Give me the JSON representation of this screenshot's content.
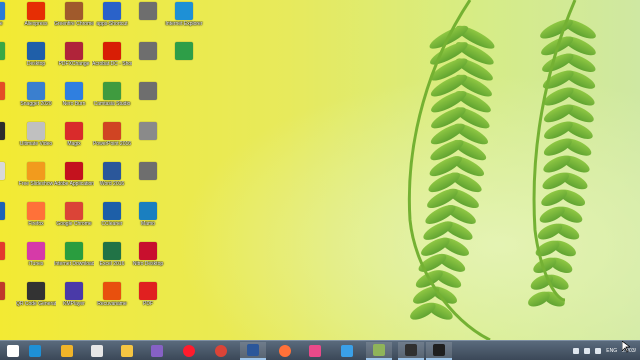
{
  "desktop": {
    "icons": [
      {
        "id": "ic-c0r0",
        "label": "...nDe",
        "color": "#2b7bd6",
        "col": 0,
        "row": 0
      },
      {
        "id": "ic-c0r1",
        "label": "",
        "color": "#39a845",
        "col": 0,
        "row": 1
      },
      {
        "id": "ic-c0r2",
        "label": "",
        "color": "#e44d26",
        "col": 0,
        "row": 2
      },
      {
        "id": "ic-c0r3",
        "label": "",
        "color": "#2d2d2d",
        "col": 0,
        "row": 3
      },
      {
        "id": "ic-c0r4",
        "label": "",
        "color": "#d8d8d8",
        "col": 0,
        "row": 4
      },
      {
        "id": "ic-c0r5",
        "label": "",
        "color": "#1e63b5",
        "col": 0,
        "row": 5
      },
      {
        "id": "ic-c0r6",
        "label": "",
        "color": "#e33b2e",
        "col": 0,
        "row": 6
      },
      {
        "id": "ic-c0r7",
        "label": "",
        "color": "#c0392b",
        "col": 0,
        "row": 7
      },
      {
        "id": "ic-c1r0",
        "label": "Aliexpress",
        "color": "#e62e04",
        "col": 1,
        "row": 0
      },
      {
        "id": "ic-c1r1",
        "label": "Desktop",
        "color": "#1f5fa9",
        "col": 1,
        "row": 1
      },
      {
        "id": "ic-c1r2",
        "label": "Snagget 2020",
        "color": "#3a7fcf",
        "col": 1,
        "row": 2
      },
      {
        "id": "ic-c1r3",
        "label": "Ultimate Video",
        "color": "#c0c0c0",
        "col": 1,
        "row": 3
      },
      {
        "id": "ic-c1r4",
        "label": "Free Slideshow",
        "color": "#f29b1d",
        "col": 1,
        "row": 4
      },
      {
        "id": "ic-c1r5",
        "label": "Firefox",
        "color": "#ff7139",
        "col": 1,
        "row": 5
      },
      {
        "id": "ic-c1r6",
        "label": "iTunes",
        "color": "#d63aa8",
        "col": 1,
        "row": 6
      },
      {
        "id": "ic-c1r7",
        "label": "QR Code Generator",
        "color": "#333333",
        "col": 1,
        "row": 7
      },
      {
        "id": "ic-c2r0",
        "label": "Greenfire Chrome",
        "color": "#a05a2c",
        "col": 2,
        "row": 0
      },
      {
        "id": "ic-c2r1",
        "label": "PDFXChange",
        "color": "#b0243a",
        "col": 2,
        "row": 1
      },
      {
        "id": "ic-c2r2",
        "label": "Nero Burn",
        "color": "#2f7fe0",
        "col": 2,
        "row": 2
      },
      {
        "id": "ic-c2r3",
        "label": "Magix",
        "color": "#d92b2b",
        "col": 2,
        "row": 3
      },
      {
        "id": "ic-c2r4",
        "label": "Adobe Application",
        "color": "#c4121e",
        "col": 2,
        "row": 4
      },
      {
        "id": "ic-c2r5",
        "label": "Google Chrome",
        "color": "#db4437",
        "col": 2,
        "row": 5
      },
      {
        "id": "ic-c2r6",
        "label": "Internet Download",
        "color": "#2a9d3f",
        "col": 2,
        "row": 6
      },
      {
        "id": "ic-c2r7",
        "label": "KMPlayer",
        "color": "#4a3aa8",
        "col": 2,
        "row": 7
      },
      {
        "id": "ic-c3r0",
        "label": "apps-Shortcut",
        "color": "#2a62c9",
        "col": 3,
        "row": 0
      },
      {
        "id": "ic-c3r1",
        "label": "Acrobat DC - Shortcut",
        "color": "#d81e05",
        "col": 3,
        "row": 1
      },
      {
        "id": "ic-c3r2",
        "label": "Camtasia Studio",
        "color": "#3f9b3f",
        "col": 3,
        "row": 2
      },
      {
        "id": "ic-c3r3",
        "label": "PowerPoint 2016",
        "color": "#d04423",
        "col": 3,
        "row": 3
      },
      {
        "id": "ic-c3r4",
        "label": "Word 2016",
        "color": "#2b579a",
        "col": 3,
        "row": 4
      },
      {
        "id": "ic-c3r5",
        "label": "CCleaner",
        "color": "#1d5fa8",
        "col": 3,
        "row": 5
      },
      {
        "id": "ic-c3r6",
        "label": "Excel 2016",
        "color": "#217346",
        "col": 3,
        "row": 6
      },
      {
        "id": "ic-c3r7",
        "label": "Recuvaname",
        "color": "#e8500e",
        "col": 3,
        "row": 7
      },
      {
        "id": "ic-c4r0",
        "label": "",
        "color": "#6e6e6e",
        "col": 4,
        "row": 0
      },
      {
        "id": "ic-c4r1",
        "label": "",
        "color": "#6e6e6e",
        "col": 4,
        "row": 1
      },
      {
        "id": "ic-c4r2",
        "label": "",
        "color": "#6e6e6e",
        "col": 4,
        "row": 2
      },
      {
        "id": "ic-c4r3",
        "label": "",
        "color": "#8a8a8a",
        "col": 4,
        "row": 3
      },
      {
        "id": "ic-c4r4",
        "label": "",
        "color": "#6e6e6e",
        "col": 4,
        "row": 4
      },
      {
        "id": "ic-c4r5",
        "label": "Mamo",
        "color": "#1a7fc0",
        "col": 4,
        "row": 5
      },
      {
        "id": "ic-c4r6",
        "label": "Nitro Desktop",
        "color": "#c8102e",
        "col": 4,
        "row": 6
      },
      {
        "id": "ic-c4r7",
        "label": "PDF",
        "color": "#e02020",
        "col": 4,
        "row": 7
      },
      {
        "id": "ic-c5r0",
        "label": "Internet Explorer",
        "color": "#1e90d6",
        "col": 5,
        "row": 0
      },
      {
        "id": "ic-c5r1",
        "label": "",
        "color": "#2e9e48",
        "col": 5,
        "row": 1
      }
    ]
  },
  "taskbar": {
    "apps": [
      {
        "id": "tb-start",
        "name": "start-icon",
        "color": "#ffffff"
      },
      {
        "id": "tb-ie",
        "name": "internet-explorer-icon",
        "color": "#1e90d6"
      },
      {
        "id": "tb-explorer",
        "name": "media-icon",
        "color": "#f0b429"
      },
      {
        "id": "tb-settings",
        "name": "settings-icon",
        "color": "#e6e6e6"
      },
      {
        "id": "tb-folder",
        "name": "file-explorer-icon",
        "color": "#f5c542"
      },
      {
        "id": "tb-vs",
        "name": "visual-studio-icon",
        "color": "#8661c5"
      },
      {
        "id": "tb-opera",
        "name": "opera-icon",
        "color": "#ff1b2d"
      },
      {
        "id": "tb-chrome",
        "name": "chrome-icon",
        "color": "#db4437"
      },
      {
        "id": "tb-word",
        "name": "word-icon",
        "color": "#2b579a"
      },
      {
        "id": "tb-firefox",
        "name": "firefox-icon",
        "color": "#ff7139"
      },
      {
        "id": "tb-pinwheel",
        "name": "pinwheel-icon",
        "color": "#e84a8a"
      },
      {
        "id": "tb-ie2",
        "name": "edge-icon",
        "color": "#3aa0e8"
      },
      {
        "id": "tb-image",
        "name": "photo-viewer-icon",
        "color": "#8fb45a"
      },
      {
        "id": "tb-camera",
        "name": "camera-icon",
        "color": "#303030"
      },
      {
        "id": "tb-capture",
        "name": "screen-capture-icon",
        "color": "#1f1f1f"
      }
    ],
    "tray": {
      "lang": "ENG",
      "date": "27/03/"
    }
  }
}
